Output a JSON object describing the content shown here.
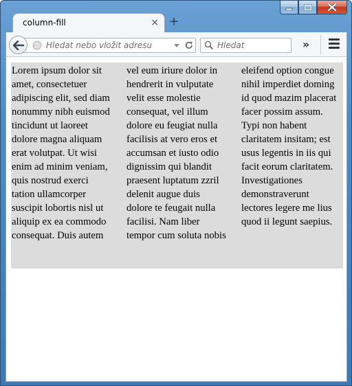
{
  "window": {
    "caption_buttons": [
      "minimize-icon",
      "maximize-icon",
      "close-icon"
    ]
  },
  "tabs": [
    {
      "title": "column-fill",
      "close_glyph": "×"
    }
  ],
  "new_tab_glyph": "+",
  "navbar": {
    "url_placeholder": "Hledat nebo vložit adresu",
    "search_placeholder": "Hledat",
    "overflow_glyph": "»",
    "icons": [
      "back-arrow-icon",
      "globe-icon",
      "dropdown-arrow-icon",
      "reload-icon",
      "search-icon",
      "overflow-chevron-icon",
      "hamburger-menu-icon"
    ]
  },
  "content": {
    "multicol_text": "Lorem ipsum dolor sit amet, consectetuer adipiscing elit, sed diam nonummy nibh euismod tincidunt ut laoreet dolore magna aliquam erat volutpat. Ut wisi enim ad minim veniam, quis nostrud exerci tation ullamcorper suscipit lobortis nisl ut aliquip ex ea commodo consequat. Duis autem vel eum iriure dolor in hendrerit in vulputate velit esse molestie consequat, vel illum dolore eu feugiat nulla facilisis at vero eros et accumsan et iusto odio dignissim qui blandit praesent luptatum zzril delenit augue duis dolore te feugait nulla facilisi. Nam liber tempor cum soluta nobis eleifend option congue nihil imperdiet doming id quod mazim placerat facer possim assum. Typi non habent claritatem insitam; est usus legentis in iis qui facit eorum claritatem. Investigationes demonstraverunt lectores legere me lius quod ii legunt saepius.",
    "background_color": "#dcdcdc"
  }
}
